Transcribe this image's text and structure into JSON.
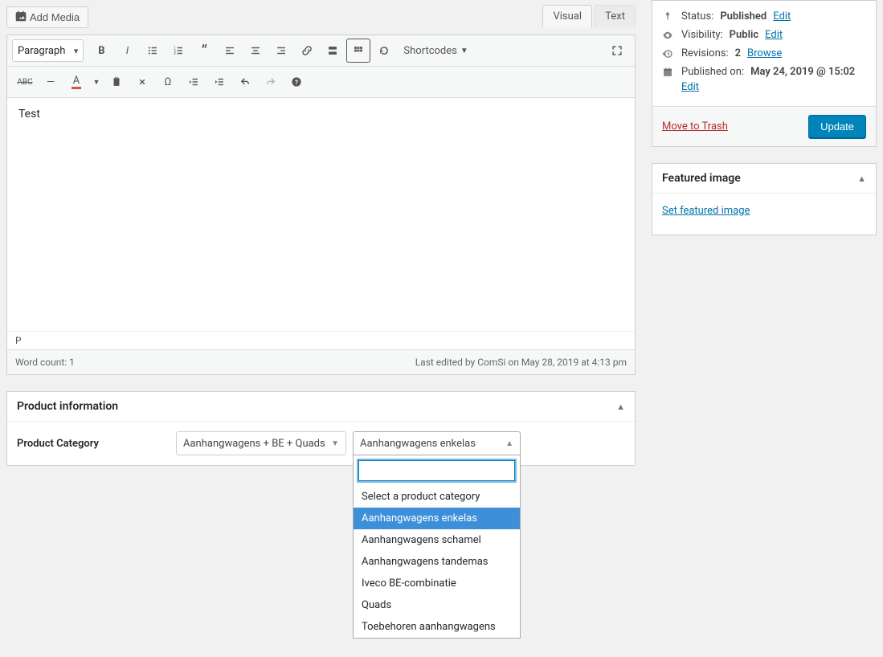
{
  "addMediaLabel": "Add Media",
  "editorTabs": {
    "visual": "Visual",
    "text": "Text"
  },
  "formatSelect": "Paragraph",
  "shortcodesLabel": "Shortcodes",
  "editorContent": "Test",
  "editorPath": "P",
  "wordCountLabel": "Word count: 1",
  "lastEdited": "Last edited by ComSi on May 28, 2019 at 4:13 pm",
  "productInfo": {
    "title": "Product information",
    "categoryLabel": "Product Category",
    "select1": "Aanhangwagens + BE + Quads",
    "select2": "Aanhangwagens enkelas",
    "options": [
      "Select a product category",
      "Aanhangwagens enkelas",
      "Aanhangwagens schamel",
      "Aanhangwagens tandemas",
      "Iveco BE-combinatie",
      "Quads",
      "Toebehoren aanhangwagens"
    ]
  },
  "publish": {
    "statusLabel": "Status:",
    "statusValue": "Published",
    "visibilityLabel": "Visibility:",
    "visibilityValue": "Public",
    "revisionsLabel": "Revisions:",
    "revisionsValue": "2",
    "browseLabel": "Browse",
    "publishedOnLabel": "Published on:",
    "publishedOnValue": "May 24, 2019 @ 15:02",
    "editLabel": "Edit",
    "trashLabel": "Move to Trash",
    "updateLabel": "Update"
  },
  "featuredImage": {
    "title": "Featured image",
    "setLabel": "Set featured image"
  }
}
